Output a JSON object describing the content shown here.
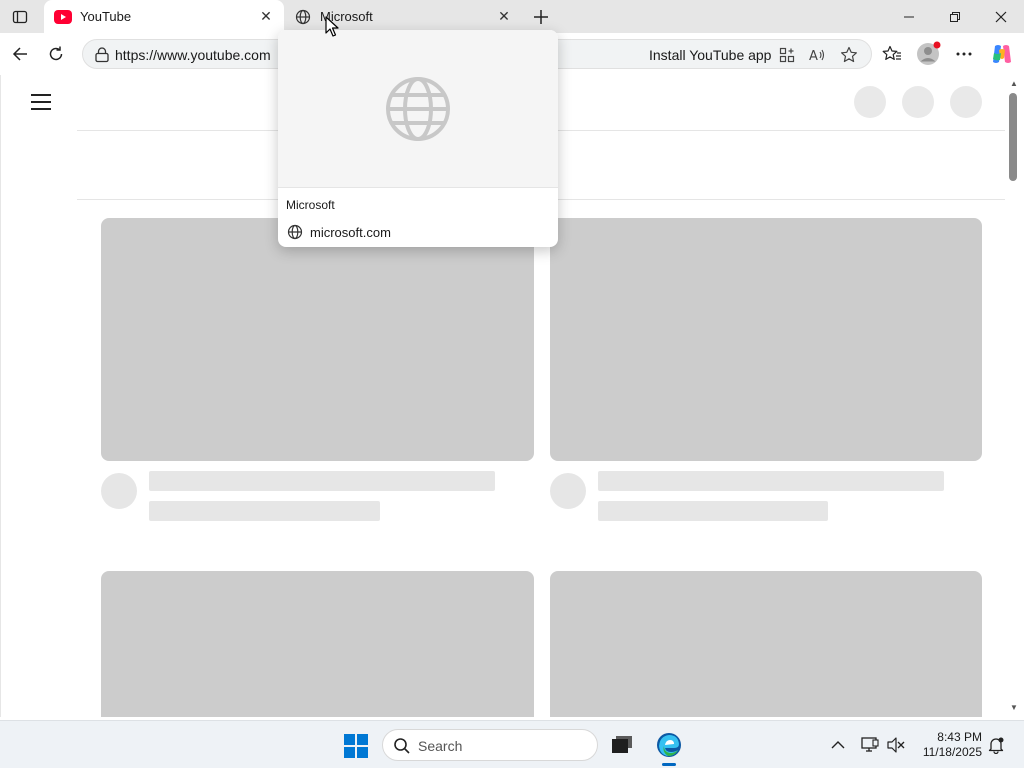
{
  "browser": {
    "tabs": [
      {
        "title": "YouTube",
        "favicon": "youtube-icon",
        "active": true
      },
      {
        "title": "Microsoft",
        "favicon": "globe-icon",
        "active": false
      }
    ],
    "address_bar": {
      "url": "https://www.youtube.com",
      "install_label": "Install YouTube app"
    }
  },
  "hover_card": {
    "title": "Microsoft",
    "domain": "microsoft.com"
  },
  "taskbar": {
    "search_placeholder": "Search",
    "time": "8:43 PM",
    "date": "11/18/2025"
  },
  "colors": {
    "youtube_red": "#ff0033",
    "placeholder_gray": "#cccccc",
    "edge_blue": "#0067c0"
  }
}
